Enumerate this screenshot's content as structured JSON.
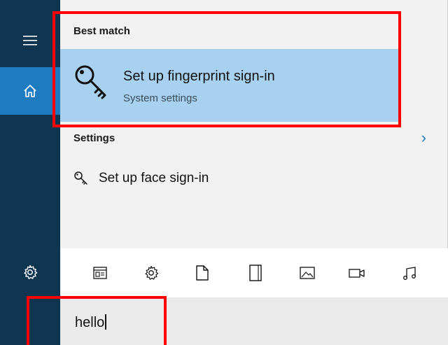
{
  "sections": {
    "best_match_label": "Best match",
    "settings_label": "Settings"
  },
  "best_match": {
    "title": "Set up fingerprint sign-in",
    "subtitle": "System settings",
    "icon": "key-icon"
  },
  "settings_results": [
    {
      "label": "Set up face sign-in",
      "icon": "key-icon"
    }
  ],
  "left_rail": {
    "items": [
      "hamburger-menu-icon",
      "home-icon",
      "settings-gear-icon"
    ],
    "active": "home-icon"
  },
  "filter_icons": [
    "apps-icon",
    "settings-icon",
    "documents-icon",
    "folders-icon",
    "photos-icon",
    "videos-icon",
    "music-icon"
  ],
  "search": {
    "value": "hello"
  },
  "colors": {
    "rail": "#0f3550",
    "rail_active": "#1f7bbf",
    "highlight": "#a8d1f0",
    "panel": "#f2f2f2",
    "annotation": "#ff0000"
  }
}
